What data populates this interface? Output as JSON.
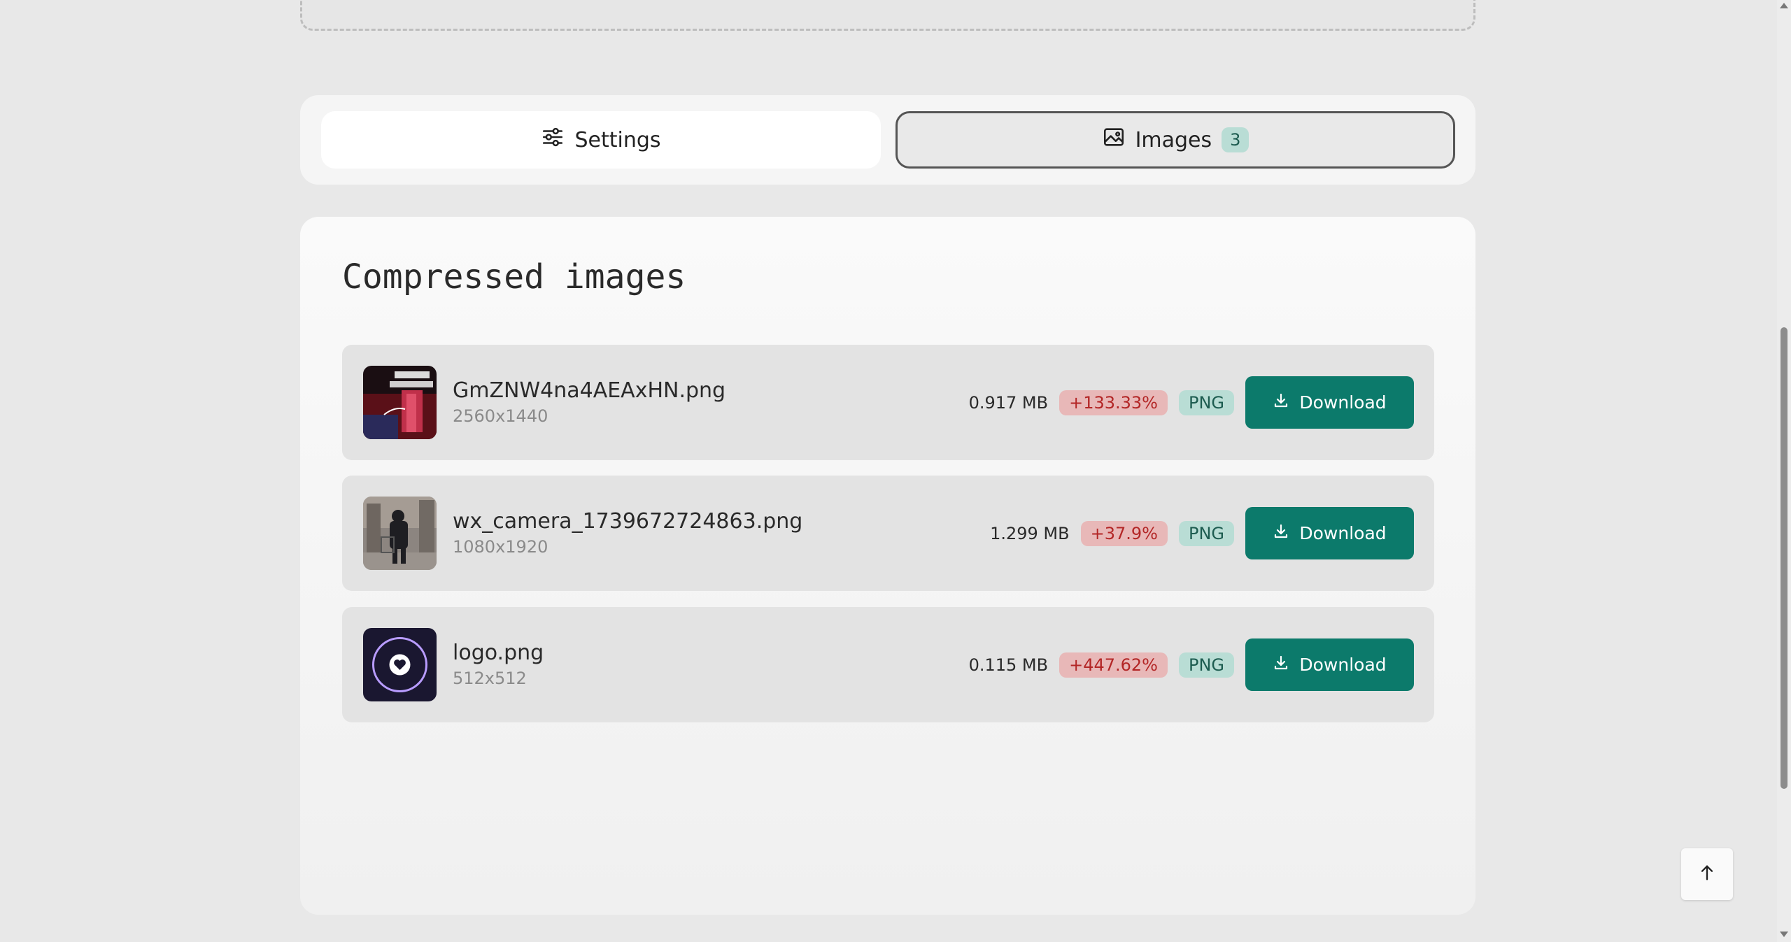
{
  "tabs": {
    "settings_label": "Settings",
    "images_label": "Images",
    "images_count": "3"
  },
  "panel": {
    "title": "Compressed images"
  },
  "images": [
    {
      "name": "GmZNW4na4AEAxHN.png",
      "dimensions": "2560x1440",
      "size": "0.917 MB",
      "change": "+133.33%",
      "format": "PNG",
      "action": "Download"
    },
    {
      "name": "wx_camera_1739672724863.png",
      "dimensions": "1080x1920",
      "size": "1.299 MB",
      "change": "+37.9%",
      "format": "PNG",
      "action": "Download"
    },
    {
      "name": "logo.png",
      "dimensions": "512x512",
      "size": "0.115 MB",
      "change": "+447.62%",
      "format": "PNG",
      "action": "Download"
    }
  ],
  "icons": {
    "settings": "sliders-icon",
    "images": "image-icon",
    "download": "download-icon",
    "scroll_top": "arrow-up-icon"
  },
  "colors": {
    "accent": "#0c7a6b",
    "badge_green_bg": "#b9ddd5",
    "badge_red_bg": "#e8b8b8",
    "badge_red_text": "#b32626"
  }
}
